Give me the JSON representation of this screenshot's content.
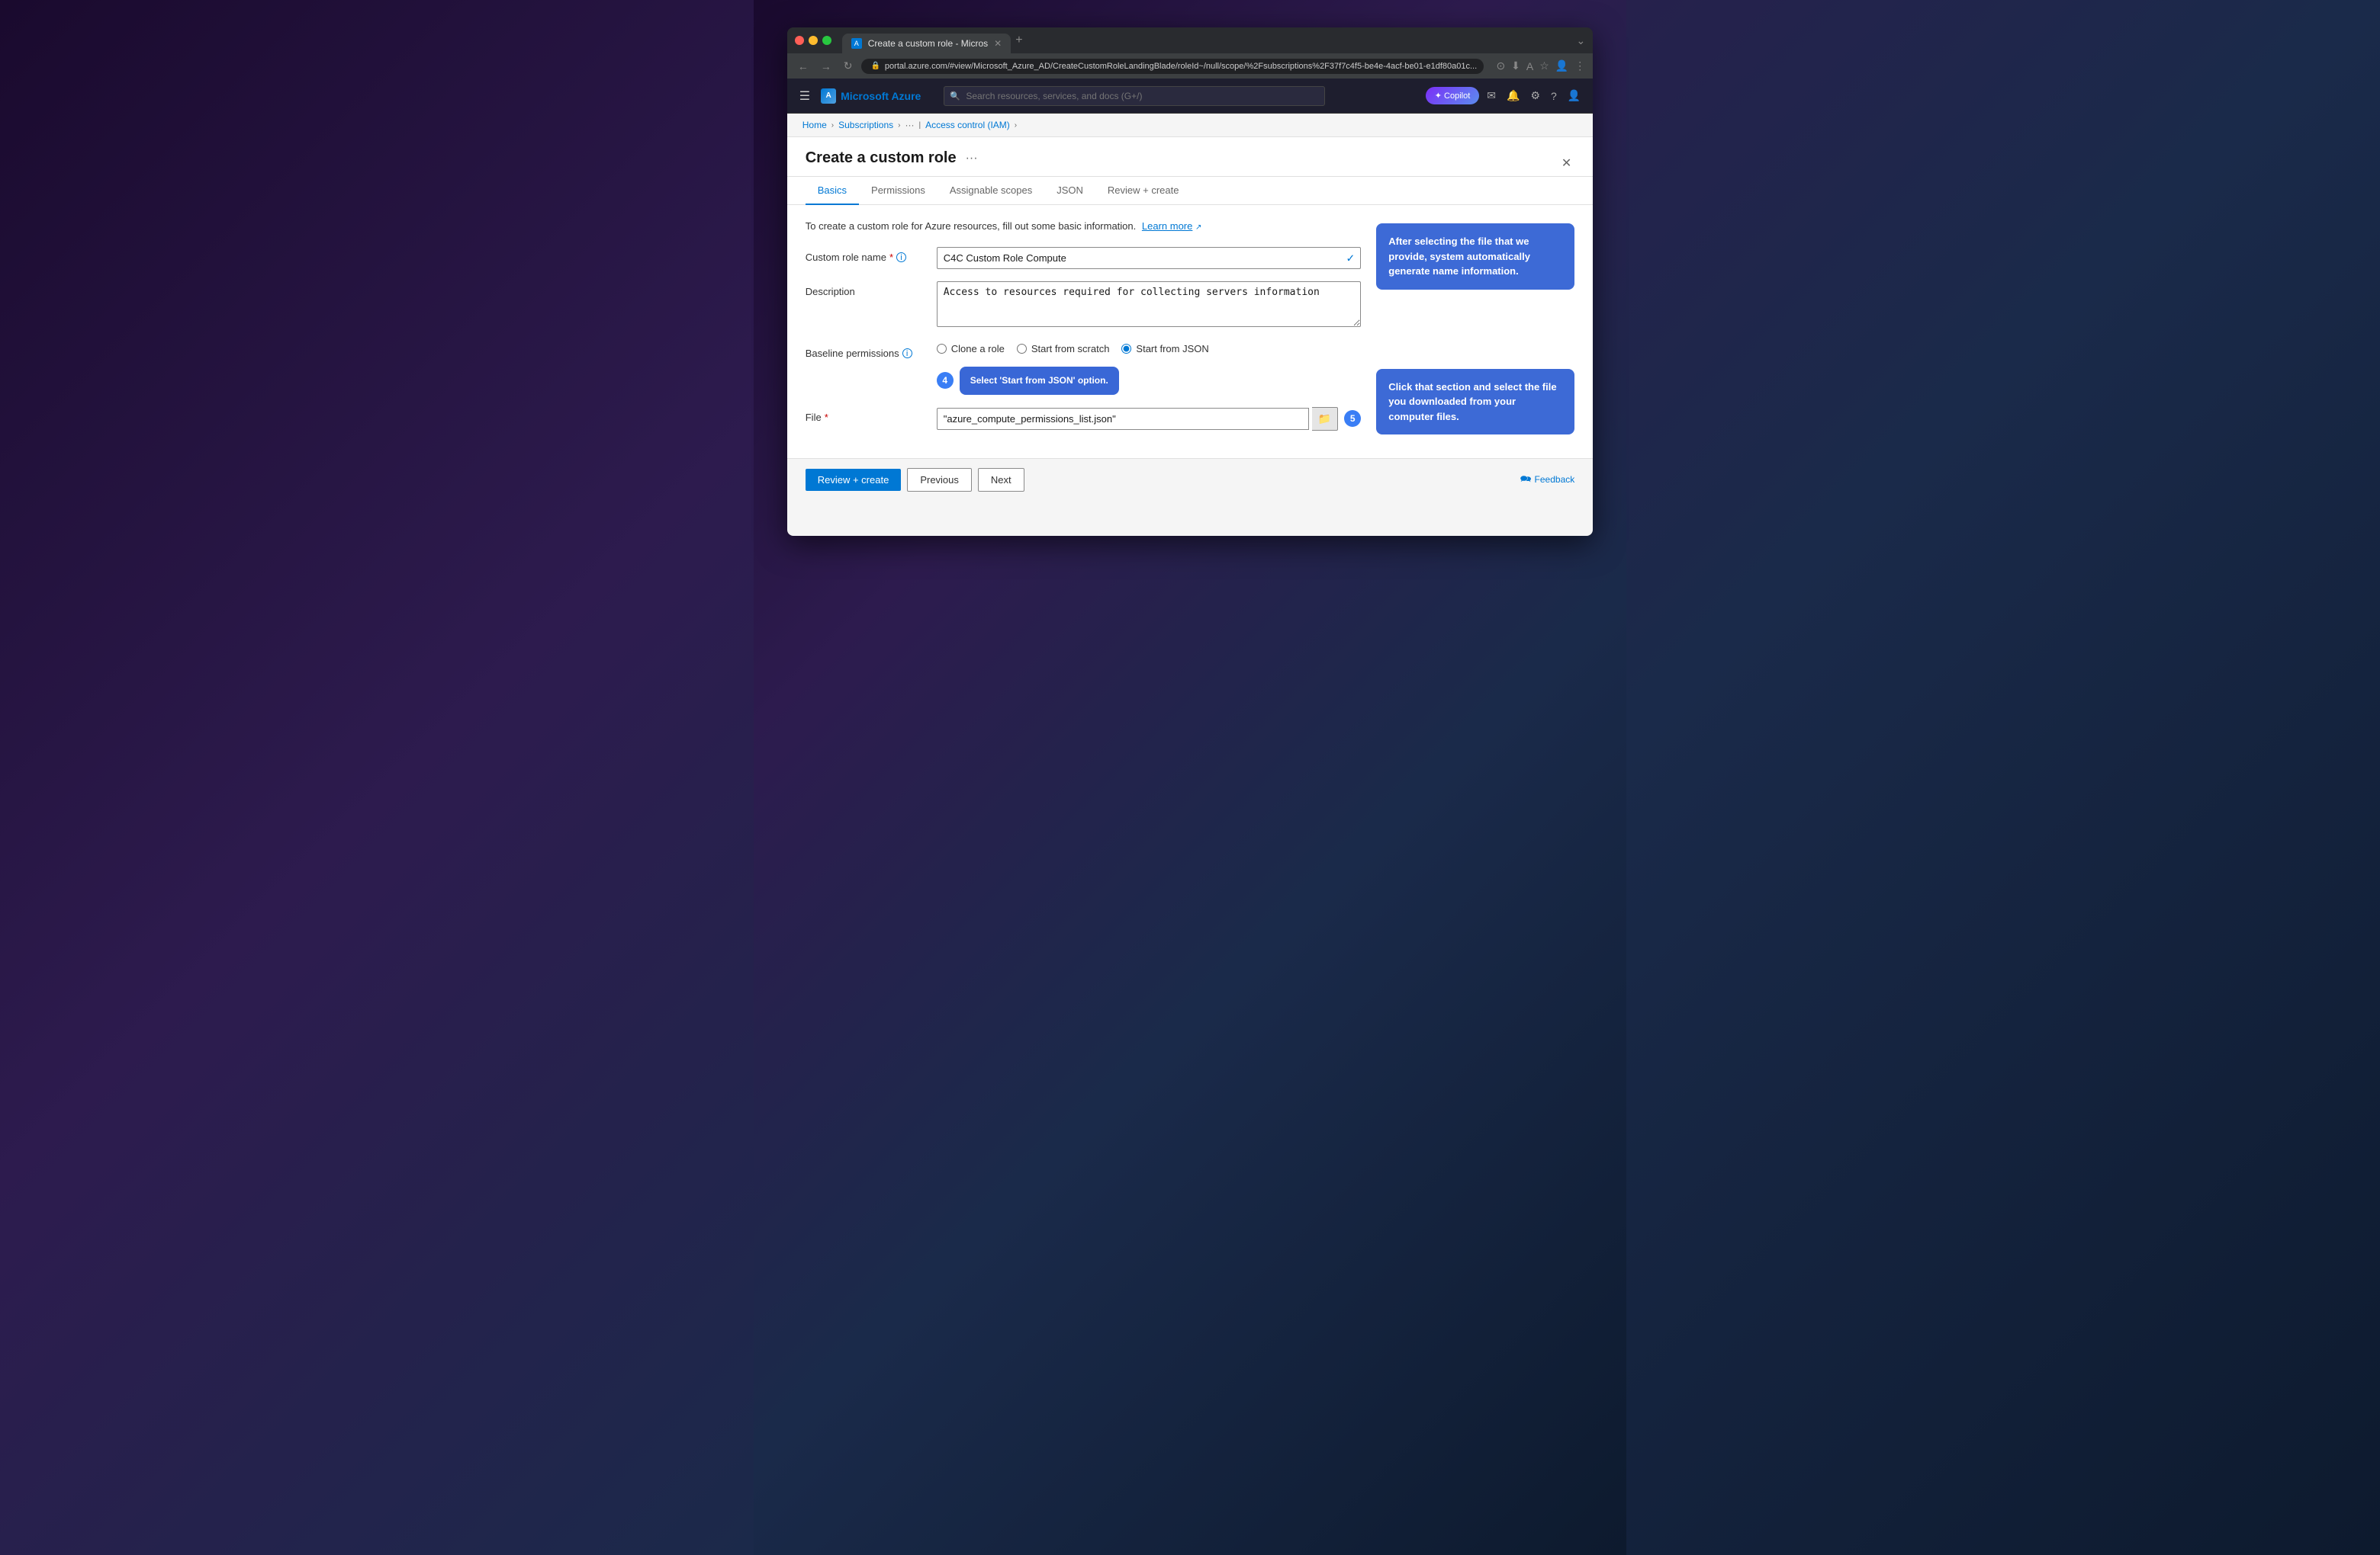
{
  "browser": {
    "tab_title": "Create a custom role - Micros",
    "tab_favicon": "A",
    "url": "portal.azure.com/#view/Microsoft_Azure_AD/CreateCustomRoleLandingBlade/roleId~/null/scope/%2Fsubscriptions%2F37f7c4f5-be4e-4acf-be01-e1df80a01c...",
    "nav_back": "←",
    "nav_forward": "→",
    "nav_refresh": "↻"
  },
  "azure_topbar": {
    "hamburger": "☰",
    "logo_text": "Microsoft Azure",
    "search_placeholder": "Search resources, services, and docs (G+/)",
    "copilot_label": "✦ Copilot",
    "icons": [
      "✉",
      "🔔",
      "⚙",
      "?",
      "👤"
    ]
  },
  "breadcrumb": {
    "home": "Home",
    "subscriptions": "Subscriptions",
    "sub_name": "···",
    "iam": "Access control (IAM)"
  },
  "panel": {
    "title": "Create a custom role",
    "more_btn": "···",
    "close_btn": "✕"
  },
  "tabs": [
    {
      "id": "basics",
      "label": "Basics",
      "active": true
    },
    {
      "id": "permissions",
      "label": "Permissions",
      "active": false
    },
    {
      "id": "assignable-scopes",
      "label": "Assignable scopes",
      "active": false
    },
    {
      "id": "json",
      "label": "JSON",
      "active": false
    },
    {
      "id": "review-create",
      "label": "Review + create",
      "active": false
    }
  ],
  "form": {
    "intro": "To create a custom role for Azure resources, fill out some basic information.",
    "learn_more": "Learn more",
    "custom_role_name_label": "Custom role name",
    "custom_role_name_required": "*",
    "custom_role_name_value": "C4C Custom Role Compute",
    "description_label": "Description",
    "description_value": "Access to resources required for collecting servers information",
    "baseline_label": "Baseline permissions",
    "baseline_info": "ℹ",
    "radio_options": [
      {
        "id": "clone",
        "label": "Clone a role",
        "checked": false
      },
      {
        "id": "scratch",
        "label": "Start from scratch",
        "checked": false
      },
      {
        "id": "json",
        "label": "Start from JSON",
        "checked": true
      }
    ],
    "file_label": "File",
    "file_required": "*",
    "file_value": "\"azure_compute_permissions_list.json\"",
    "file_browse_icon": "📁"
  },
  "annotations": {
    "step4_label": "4",
    "step4_tooltip": "Select 'Start from JSON' option.",
    "step5_label": "5",
    "step5_tooltip": "Click that section and select the file you downloaded from your computer files.",
    "callout1": "After selecting the file that we provide, system automatically generate name information."
  },
  "bottom_bar": {
    "review_create_label": "Review + create",
    "previous_label": "Previous",
    "next_label": "Next",
    "feedback_icon": "🗪",
    "feedback_label": "Feedback"
  }
}
